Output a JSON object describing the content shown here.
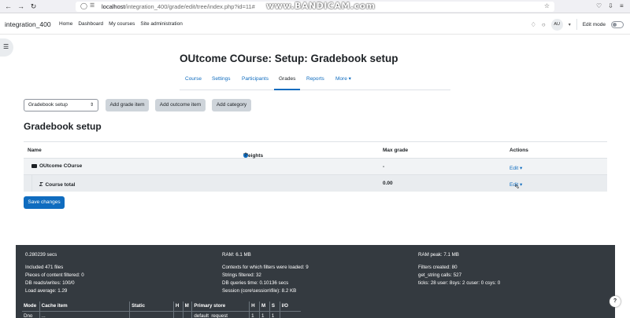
{
  "browser": {
    "url_host": "localhost",
    "url_path": "/integration_400/grade/edit/tree/index.php?id=11#",
    "watermark": "www.BANDICAM.com"
  },
  "navbar": {
    "site_name": "integration_400",
    "links": [
      "Home",
      "Dashboard",
      "My courses",
      "Site administration"
    ],
    "avatar_initials": "AU",
    "edit_mode_label": "Edit mode"
  },
  "header": {
    "title": "OUtcome COurse: Setup: Gradebook setup",
    "tabs": [
      "Course",
      "Settings",
      "Participants",
      "Grades",
      "Reports",
      "More"
    ],
    "more_caret": "▾",
    "active_tab": "Grades"
  },
  "actions": {
    "select_value": "Gradebook setup",
    "add_grade_item": "Add grade item",
    "add_outcome_item": "Add outcome item",
    "add_category": "Add category"
  },
  "section_title": "Gradebook setup",
  "table": {
    "headers": {
      "name": "Name",
      "weights": "Weights",
      "max_grade": "Max grade",
      "actions": "Actions"
    },
    "rows": [
      {
        "name": "OUtcome COurse",
        "max_grade": "-",
        "action": "Edit"
      },
      {
        "name": "Course total",
        "max_grade": "0.00",
        "action": "Edit"
      }
    ]
  },
  "save_button": "Save changes",
  "footer": {
    "col1": [
      "0.280239 secs",
      "",
      "Included 471 files",
      "Pieces of content filtered: 0",
      "DB reads/writes: 100/0",
      "Load average: 1.29"
    ],
    "col2": [
      "RAM: 6.1 MB",
      "",
      "Contexts for which filters were loaded: 9",
      "Strings filtered: 32",
      "DB queries time: 0.10136 secs",
      "Session (core\\session\\file): 8.2 KB"
    ],
    "col3": [
      "RAM peak: 7.1 MB",
      "",
      "Filters created: 80",
      "get_string calls: 527",
      "ticks: 28 user: 8sys: 2 cuser: 0 csys: 0"
    ],
    "cache_headers": [
      "Mode",
      "Cache item",
      "Static",
      "H",
      "M",
      "Primary store",
      "H",
      "M",
      "S",
      "I/O"
    ],
    "cache_row": [
      "Dno",
      "...",
      "",
      "",
      "",
      "default_request",
      "1",
      "1",
      "1",
      ""
    ]
  },
  "help_label": "?"
}
